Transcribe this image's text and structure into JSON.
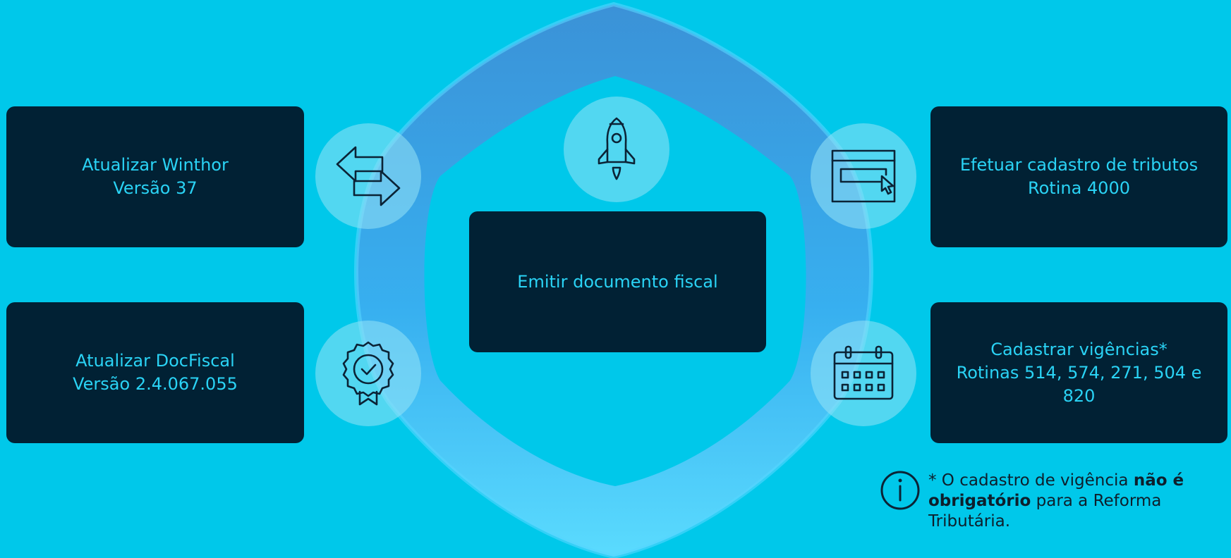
{
  "center_card": {
    "label": "Emitir documento fiscal"
  },
  "steps": [
    {
      "line1": "Atualizar Winthor",
      "line2": "Versão 37"
    },
    {
      "line1": "Atualizar DocFiscal",
      "line2": "Versão 2.4.067.055"
    },
    {
      "line1": "Efetuar cadastro de tributos",
      "line2": "Rotina 4000"
    },
    {
      "line1": "Cadastrar vigências*",
      "line2": "Rotinas 514, 574, 271, 504 e 820"
    }
  ],
  "icons": {
    "top": "rocket-icon",
    "left_top": "swap-arrows-icon",
    "left_bottom": "certified-badge-icon",
    "right_top": "browser-click-icon",
    "right_bottom": "calendar-icon"
  },
  "footnote": {
    "prefix": "* O cadastro de vigência ",
    "bold": "não é obrigatório",
    "suffix": " para a Reforma Tributária."
  },
  "colors": {
    "background": "#00c8ea",
    "card": "#012134",
    "card_text": "#2ad3f5"
  }
}
